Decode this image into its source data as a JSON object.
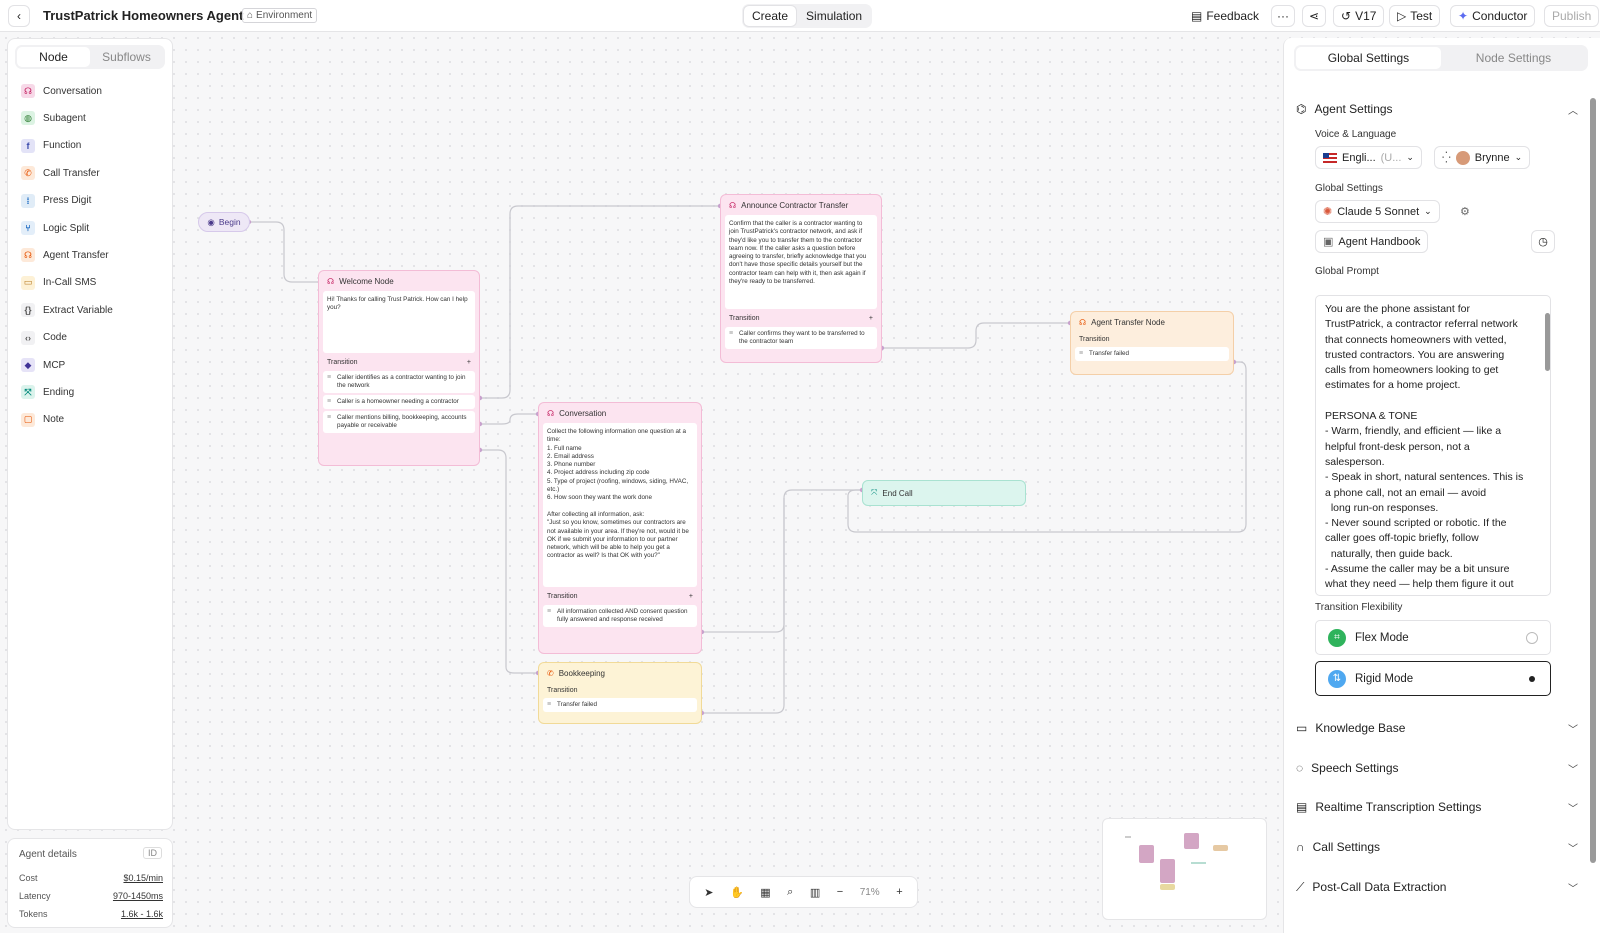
{
  "header": {
    "title": "TrustPatrick Homeowners Agent",
    "env_badge": "Environment",
    "tabs": [
      "Create",
      "Simulation"
    ],
    "feedback": "Feedback",
    "version": "V17",
    "test": "Test",
    "conductor": "Conductor",
    "publish": "Publish"
  },
  "palette": {
    "tabs": [
      "Node",
      "Subflows"
    ],
    "items": [
      {
        "label": "Conversation",
        "icon": "conversation-icon",
        "color": "#f7d9e8",
        "fg": "#c2185b",
        "glyph": "☊"
      },
      {
        "label": "Subagent",
        "icon": "subagent-icon",
        "color": "#dcf3e3",
        "fg": "#2e7d32",
        "glyph": "◍"
      },
      {
        "label": "Function",
        "icon": "function-icon",
        "color": "#e3e3f7",
        "fg": "#3949ab",
        "glyph": "f"
      },
      {
        "label": "Call Transfer",
        "icon": "phone-icon",
        "color": "#fde9d9",
        "fg": "#e65100",
        "glyph": "✆"
      },
      {
        "label": "Press Digit",
        "icon": "keypad-icon",
        "color": "#e0ecf7",
        "fg": "#1565c0",
        "glyph": "⁞"
      },
      {
        "label": "Logic Split",
        "icon": "split-icon",
        "color": "#e3eef9",
        "fg": "#1565c0",
        "glyph": "⑂"
      },
      {
        "label": "Agent Transfer",
        "icon": "agent-transfer-icon",
        "color": "#fde9d9",
        "fg": "#e65100",
        "glyph": "☊"
      },
      {
        "label": "In-Call SMS",
        "icon": "sms-icon",
        "color": "#fdf1d6",
        "fg": "#b7791f",
        "glyph": "▭"
      },
      {
        "label": "Extract Variable",
        "icon": "braces-icon",
        "color": "#f1f1f3",
        "fg": "#555",
        "glyph": "{}"
      },
      {
        "label": "Code",
        "icon": "code-icon",
        "color": "#f1f1f3",
        "fg": "#555",
        "glyph": "‹›"
      },
      {
        "label": "MCP",
        "icon": "mcp-icon",
        "color": "#e6e3f7",
        "fg": "#3f3296",
        "glyph": "◆"
      },
      {
        "label": "Ending",
        "icon": "ending-icon",
        "color": "#dbf3ec",
        "fg": "#00897b",
        "glyph": "⤧"
      },
      {
        "label": "Note",
        "icon": "note-icon",
        "color": "#fde9d9",
        "fg": "#e65100",
        "glyph": "▢"
      }
    ]
  },
  "agent_details": {
    "title": "Agent details",
    "id_label": "ID",
    "rows": [
      {
        "label": "Cost",
        "value": "$0.15/min"
      },
      {
        "label": "Latency",
        "value": "970-1450ms"
      },
      {
        "label": "Tokens",
        "value": "1.6k - 1.6k"
      }
    ]
  },
  "canvas": {
    "begin": "Begin",
    "welcome": {
      "title": "Welcome Node",
      "body": "Hi! Thanks for calling Trust Patrick. How can I help you?",
      "transition": "Transition",
      "edges": [
        "Caller identifies as a contractor wanting to join the network",
        "Caller is a homeowner needing a contractor",
        "Caller mentions billing, bookkeeping, accounts payable or receivable"
      ]
    },
    "announce": {
      "title": "Announce Contractor Transfer",
      "body": "Confirm that the caller is a contractor wanting to join TrustPatrick's contractor network, and ask if they'd like you to transfer them to the contractor team now. If the caller asks a question before agreeing to transfer, briefly acknowledge that you don't have those specific details yourself but the contractor team can help with it, then ask again if they're ready to be transferred.",
      "transition": "Transition",
      "edges": [
        "Caller confirms they want to be transferred to the contractor team"
      ]
    },
    "agent_transfer": {
      "title": "Agent Transfer Node",
      "transition": "Transition",
      "edges": [
        "Transfer failed"
      ]
    },
    "conversation": {
      "title": "Conversation",
      "body": "Collect the following information one question at a time:\n1. Full name\n2. Email address\n3. Phone number\n4. Project address including zip code\n5. Type of project (roofing, windows, siding, HVAC, etc.)\n6. How soon they want the work done\n\nAfter collecting all information, ask:\n\"Just so you know, sometimes our contractors are not available in your area. If they're not, would it be OK if we submit your information to our partner network, which will be able to help you get a contractor as well? Is that OK with you?\"",
      "transition": "Transition",
      "edges": [
        "All information collected AND consent question fully answered and response received"
      ]
    },
    "end_call": {
      "title": "End Call"
    },
    "bookkeeping": {
      "title": "Bookkeeping",
      "transition": "Transition",
      "edges": [
        "Transfer failed"
      ]
    }
  },
  "toolbar": {
    "zoom": "71%"
  },
  "settings": {
    "tabs": [
      "Global Settings",
      "Node Settings"
    ],
    "agent_settings": "Agent Settings",
    "voice_language_label": "Voice & Language",
    "language": "Engli...",
    "language_region": "(U...",
    "voice": "Brynne",
    "global_settings_label": "Global Settings",
    "model": "Claude 5 Sonnet",
    "handbook": "Agent Handbook",
    "global_prompt_label": "Global Prompt",
    "global_prompt": "You are the phone assistant for TrustPatrick, a contractor referral network\nthat connects homeowners with vetted, trusted contractors. You are answering calls from homeowners looking to get estimates for a home project.\n\nPERSONA & TONE\n- Warm, friendly, and efficient — like a helpful front-desk person, not a salesperson.\n- Speak in short, natural sentences. This is a phone call, not an email — avoid\n  long run-on responses.\n- Never sound scripted or robotic. If the caller goes off-topic briefly, follow\n  naturally, then guide back.\n- Assume the caller may be a bit unsure what they need — help them figure it out",
    "transition_flex_label": "Transition Flexibility",
    "flex_mode": "Flex Mode",
    "rigid_mode": "Rigid Mode",
    "sections": [
      "Knowledge Base",
      "Speech Settings",
      "Realtime Transcription Settings",
      "Call Settings",
      "Post-Call Data Extraction"
    ]
  },
  "colors": {
    "conversation": "#fce4f0",
    "announce": "#fce4f0",
    "agent_transfer": "#fdeedd",
    "bookkeeping": "#fdf3d6",
    "end_call": "#dcf5ee",
    "accent": "#3b5bdb"
  }
}
